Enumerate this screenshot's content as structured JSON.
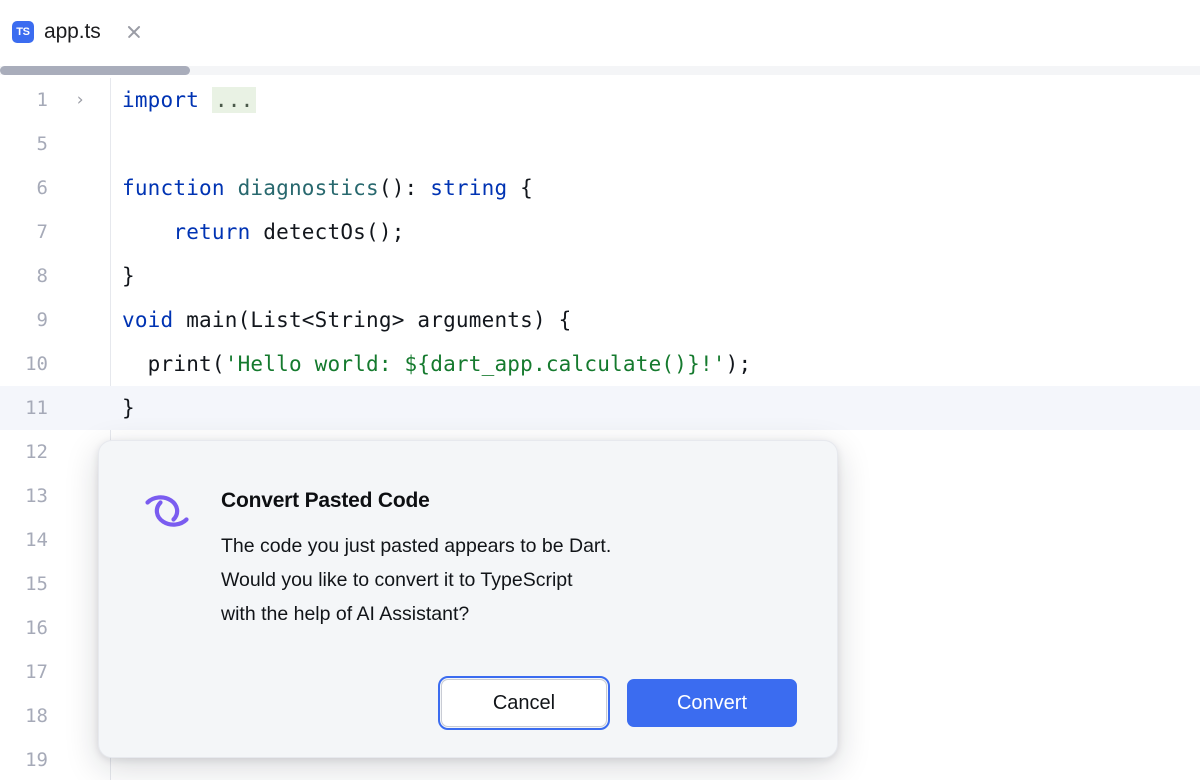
{
  "tab": {
    "file_type_badge": "TS",
    "filename": "app.ts",
    "close_icon": "close-icon"
  },
  "editor": {
    "lines": [
      {
        "number": "1",
        "fold": "›",
        "current": false,
        "tokens": [
          {
            "t": "import",
            "c": "kw"
          },
          {
            "t": " ",
            "c": "plain"
          },
          {
            "t": "...",
            "c": "foldbox"
          }
        ]
      },
      {
        "number": "5",
        "fold": "",
        "current": false,
        "tokens": []
      },
      {
        "number": "6",
        "fold": "",
        "current": false,
        "tokens": [
          {
            "t": "function ",
            "c": "kw"
          },
          {
            "t": "diagnostics",
            "c": "fn"
          },
          {
            "t": "(): ",
            "c": "plain"
          },
          {
            "t": "string",
            "c": "kw"
          },
          {
            "t": " {",
            "c": "plain"
          }
        ]
      },
      {
        "number": "7",
        "fold": "",
        "current": false,
        "tokens": [
          {
            "t": "    ",
            "c": "plain"
          },
          {
            "t": "return",
            "c": "kw"
          },
          {
            "t": " detectOs();",
            "c": "plain"
          }
        ]
      },
      {
        "number": "8",
        "fold": "",
        "current": false,
        "tokens": [
          {
            "t": "}",
            "c": "plain"
          }
        ]
      },
      {
        "number": "9",
        "fold": "",
        "current": false,
        "tokens": [
          {
            "t": "void",
            "c": "kw"
          },
          {
            "t": " main(List<String> arguments) {",
            "c": "plain"
          }
        ]
      },
      {
        "number": "10",
        "fold": "",
        "current": false,
        "tokens": [
          {
            "t": "  print(",
            "c": "plain"
          },
          {
            "t": "'Hello world: ${dart_app.calculate()}!'",
            "c": "str"
          },
          {
            "t": ");",
            "c": "plain"
          }
        ]
      },
      {
        "number": "11",
        "fold": "",
        "current": true,
        "tokens": [
          {
            "t": "}",
            "c": "plain"
          }
        ]
      },
      {
        "number": "12",
        "fold": "",
        "current": false,
        "tokens": []
      },
      {
        "number": "13",
        "fold": "",
        "current": false,
        "tokens": []
      },
      {
        "number": "14",
        "fold": "",
        "current": false,
        "tokens": []
      },
      {
        "number": "15",
        "fold": "",
        "current": false,
        "tokens": []
      },
      {
        "number": "16",
        "fold": "",
        "current": false,
        "tokens": []
      },
      {
        "number": "17",
        "fold": "",
        "current": false,
        "tokens": []
      },
      {
        "number": "18",
        "fold": "",
        "current": false,
        "tokens": []
      },
      {
        "number": "19",
        "fold": "",
        "current": false,
        "tokens": []
      }
    ]
  },
  "dialog": {
    "icon": "ai-assistant-icon",
    "title": "Convert Pasted Code",
    "message": "The code you just pasted appears to be Dart.\nWould you like to convert it to TypeScript\nwith the help of AI Assistant?",
    "cancel_label": "Cancel",
    "convert_label": "Convert"
  },
  "colors": {
    "accent_blue": "#3b6cf0",
    "ai_purple": "#7a5cf0",
    "keyword_blue": "#0033b3",
    "string_green": "#157a2e",
    "function_teal": "#28686e",
    "fold_green_bg": "#e9f2e4",
    "dialog_bg": "#f4f6f8",
    "current_line_bg": "#f4f6fb"
  }
}
